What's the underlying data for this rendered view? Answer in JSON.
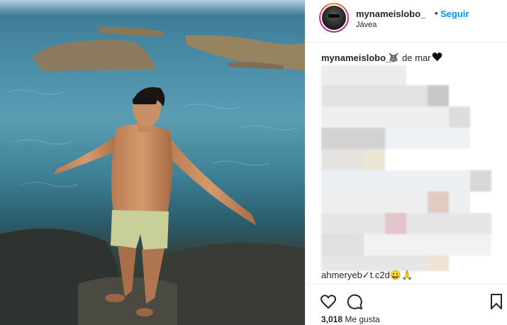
{
  "post": {
    "username": "mynameislobo_",
    "separator": "•",
    "follow_label": "Seguir",
    "location": "Jávea"
  },
  "caption": {
    "username": "mynameislobo_",
    "text": "de mar",
    "icons": [
      "wolf-emoji-icon",
      "black-heart-icon"
    ],
    "partial_tail": "ahmeryeb✓t.c2d😀🙏"
  },
  "likes": {
    "count": "3,018",
    "label": "Me gusta"
  },
  "actions": {
    "icons": [
      "like-heart-icon",
      "comment-icon",
      "bookmark-icon"
    ]
  },
  "colors": {
    "accent": "#0095f6",
    "text": "#262626",
    "border": "#efefef"
  }
}
